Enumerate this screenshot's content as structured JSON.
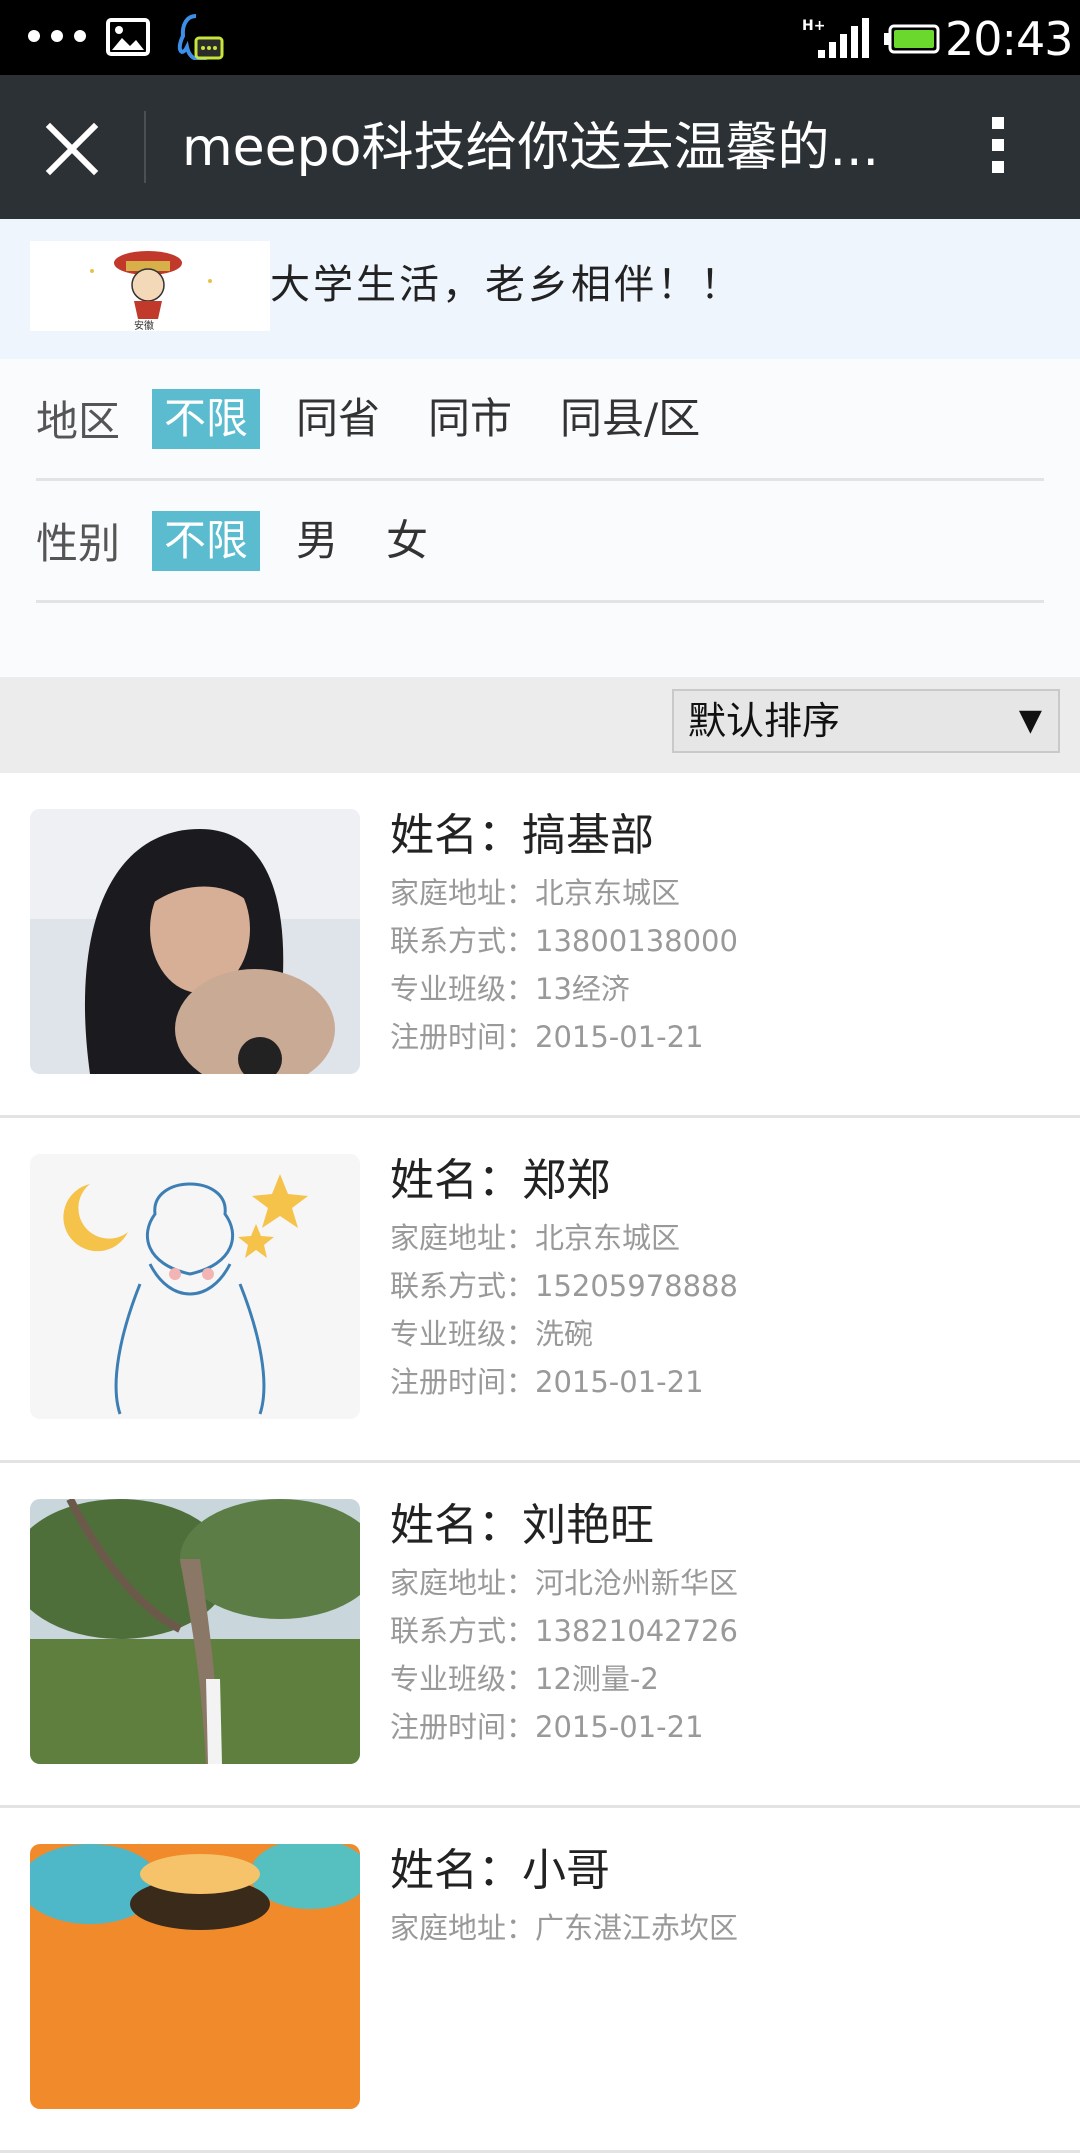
{
  "status_bar": {
    "time": "20:43",
    "network": "H+"
  },
  "title_bar": {
    "title": "meepo科技给你送去温馨的..."
  },
  "header": {
    "logo_text": "安徽",
    "slogan": "大学生活，老乡相伴！！"
  },
  "filters": {
    "region": {
      "label": "地区",
      "options": [
        "不限",
        "同省",
        "同市",
        "同县/区"
      ],
      "selected": "不限"
    },
    "gender": {
      "label": "性别",
      "options": [
        "不限",
        "男",
        "女"
      ],
      "selected": "不限"
    }
  },
  "sort": {
    "selected": "默认排序",
    "arrow": "▼"
  },
  "list": {
    "items": [
      {
        "name": "姓名：搞基部",
        "address": "家庭地址：北京东城区",
        "contact": "联系方式：13800138000",
        "class": "专业班级：13经济",
        "registered": "注册时间：2015-01-21"
      },
      {
        "name": "姓名：郑郑",
        "address": "家庭地址：北京东城区",
        "contact": "联系方式：15205978888",
        "class": "专业班级：洗碗",
        "registered": "注册时间：2015-01-21"
      },
      {
        "name": "姓名：刘艳旺",
        "address": "家庭地址：河北沧州新华区",
        "contact": "联系方式：13821042726",
        "class": "专业班级：12测量-2",
        "registered": "注册时间：2015-01-21"
      },
      {
        "name": "姓名：小哥",
        "address": "家庭地址：广东湛江赤坎区",
        "contact": "",
        "class": "",
        "registered": ""
      }
    ]
  },
  "colors": {
    "accent": "#5bbcd0",
    "title_bar": "#2b3135",
    "header_bg": "#eef5fc"
  }
}
